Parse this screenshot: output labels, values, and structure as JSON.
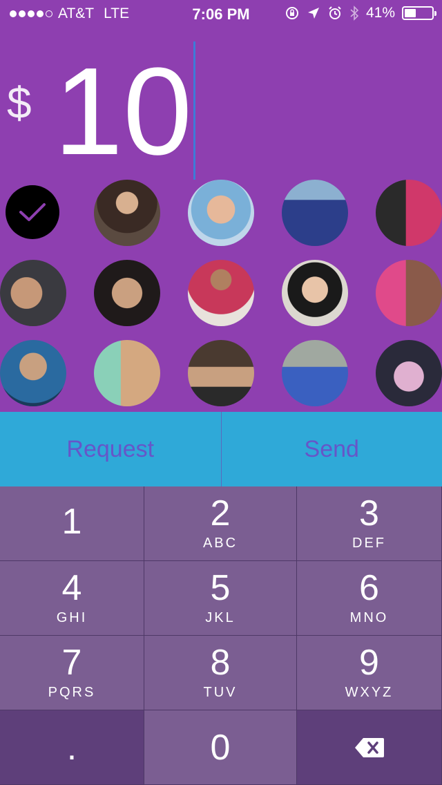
{
  "status": {
    "signal_dots": [
      true,
      true,
      true,
      true,
      false
    ],
    "carrier": "AT&T",
    "network": "LTE",
    "time": "7:06 PM",
    "battery": "41%",
    "battery_level": 0.41
  },
  "amount": {
    "currency": "$",
    "value": "10"
  },
  "actions": {
    "request_label": "Request",
    "send_label": "Send"
  },
  "keypad": [
    {
      "num": "1",
      "sub": ""
    },
    {
      "num": "2",
      "sub": "ABC"
    },
    {
      "num": "3",
      "sub": "DEF"
    },
    {
      "num": "4",
      "sub": "GHI"
    },
    {
      "num": "5",
      "sub": "JKL"
    },
    {
      "num": "6",
      "sub": "MNO"
    },
    {
      "num": "7",
      "sub": "PQRS"
    },
    {
      "num": "8",
      "sub": "TUV"
    },
    {
      "num": "9",
      "sub": "WXYZ"
    },
    {
      "num": ".",
      "sub": ""
    },
    {
      "num": "0",
      "sub": ""
    },
    {
      "num": "",
      "sub": ""
    }
  ],
  "colors": {
    "background": "#8e3fb0",
    "action_bar": "#2fa9d8",
    "action_text": "#6656c8",
    "cursor": "#3d7bd8",
    "key": "#7b5e92",
    "key_dark": "#5e3f7a"
  }
}
